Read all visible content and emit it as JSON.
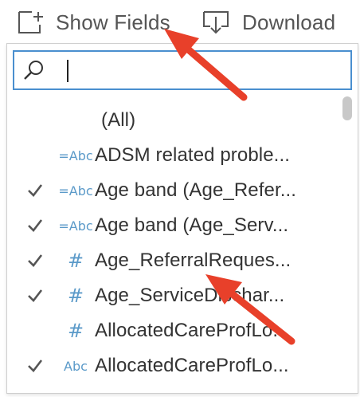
{
  "toolbar": {
    "show_fields_label": "Show Fields",
    "download_label": "Download",
    "show_fields_icon": "add-box-icon",
    "download_icon": "download-icon"
  },
  "search": {
    "value": "",
    "icon": "search-icon",
    "border_color": "#4a8fcf"
  },
  "list": {
    "items": [
      {
        "label": "(All)",
        "checked": false,
        "type": "none"
      },
      {
        "label": "ADSM related proble...",
        "checked": false,
        "type": "string"
      },
      {
        "label": "Age band (Age_Refer...",
        "checked": true,
        "type": "string"
      },
      {
        "label": "Age band (Age_Serv...",
        "checked": true,
        "type": "string"
      },
      {
        "label": "Age_ReferralReques...",
        "checked": true,
        "type": "number"
      },
      {
        "label": "Age_ServiceDischar...",
        "checked": true,
        "type": "number"
      },
      {
        "label": "AllocatedCareProfLo...",
        "checked": false,
        "type": "number"
      },
      {
        "label": "AllocatedCareProfLo...",
        "checked": true,
        "type": "string"
      }
    ],
    "type_labels": {
      "string": "=Abc",
      "string_plain": "Abc",
      "number": "#"
    }
  },
  "colors": {
    "annotation_arrow": "#e8402a",
    "type_icon": "#5b9ac9",
    "check": "#555555"
  }
}
